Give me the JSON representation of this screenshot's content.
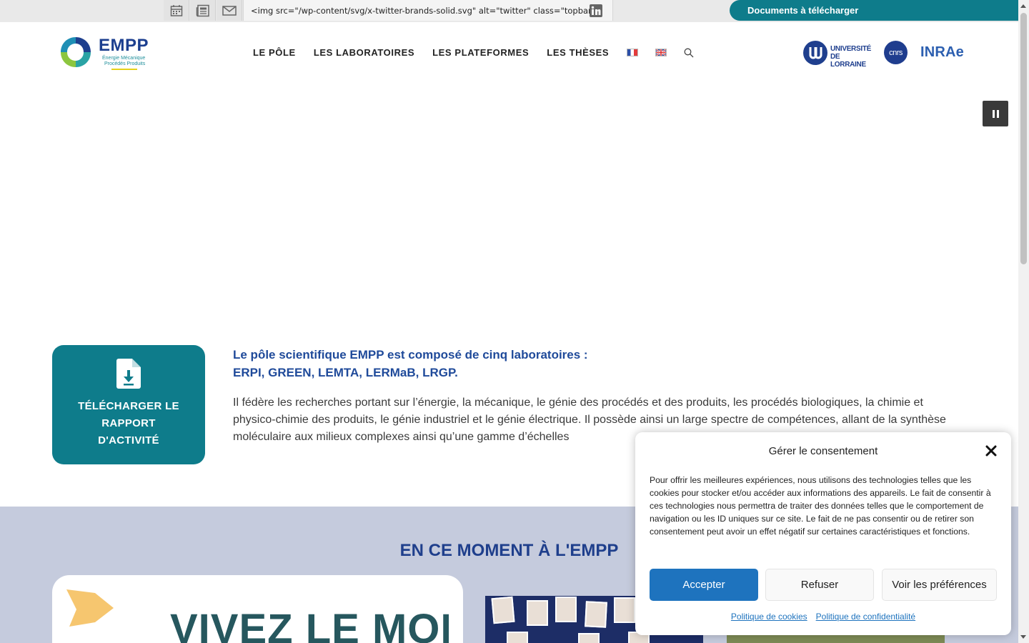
{
  "topbar": {
    "icons": [
      "calendar-icon",
      "newspaper-icon",
      "mail-icon"
    ],
    "code_snippet": "<img src=\"/wp-content/svg/x-twitter-brands-solid.svg\" alt=\"twitter\" class=\"topbar\"",
    "linkedin_icon": "linkedin-icon",
    "docs_button": "Documents à télécharger"
  },
  "header": {
    "logo": {
      "title": "EMPP",
      "subtitle_line1": "Énergie Mécanique",
      "subtitle_line2": "Procédés Produits"
    },
    "nav": [
      "LE PÔLE",
      "LES LABORATOIRES",
      "LES PLATEFORMES",
      "LES THÈSES"
    ],
    "partners": {
      "ul_line1": "UNIVERSITÉ",
      "ul_line2": "DE LORRAINE",
      "cnrs": "cnrs",
      "inrae": "INRAe"
    }
  },
  "download_card": {
    "label": "TÉLÉCHARGER LE RAPPORT D'ACTIVITÉ"
  },
  "intro": {
    "title": "Le pôle scientifique EMPP est composé de cinq laboratoires :\n ERPI, GREEN, LEMTA, LERMaB, LRGP.",
    "body": "Il fédère les recherches portant sur l’énergie, la mécanique, le génie des procédés et des produits, les procédés biologiques, la chimie et physico-chimie des produits, le génie industriel et le génie électrique. Il possède ainsi un large spectre de compétences, allant de la synthèse moléculaire aux milieux complexes ainsi qu’une gamme d’échelles"
  },
  "moment": {
    "title": "EN CE MOMENT À L'EMPP",
    "card_text": "VIVEZ LE MOI"
  },
  "consent": {
    "title": "Gérer le consentement",
    "body": "Pour offrir les meilleures expériences, nous utilisons des technologies telles que les cookies pour stocker et/ou accéder aux informations des appareils. Le fait de consentir à ces technologies nous permettra de traiter des données telles que le comportement de navigation ou les ID uniques sur ce site. Le fait de ne pas consentir ou de retirer son consentement peut avoir un effet négatif sur certaines caractéristiques et fonctions.",
    "accept": "Accepter",
    "refuse": "Refuser",
    "preferences": "Voir les préférences",
    "cookie_policy": "Politique de cookies",
    "privacy_policy": "Politique de confidentialité"
  },
  "colors": {
    "teal": "#0e7c8b",
    "navy": "#1f3f8c",
    "accept_blue": "#1e73be",
    "section_bg": "#c5cbdd"
  }
}
